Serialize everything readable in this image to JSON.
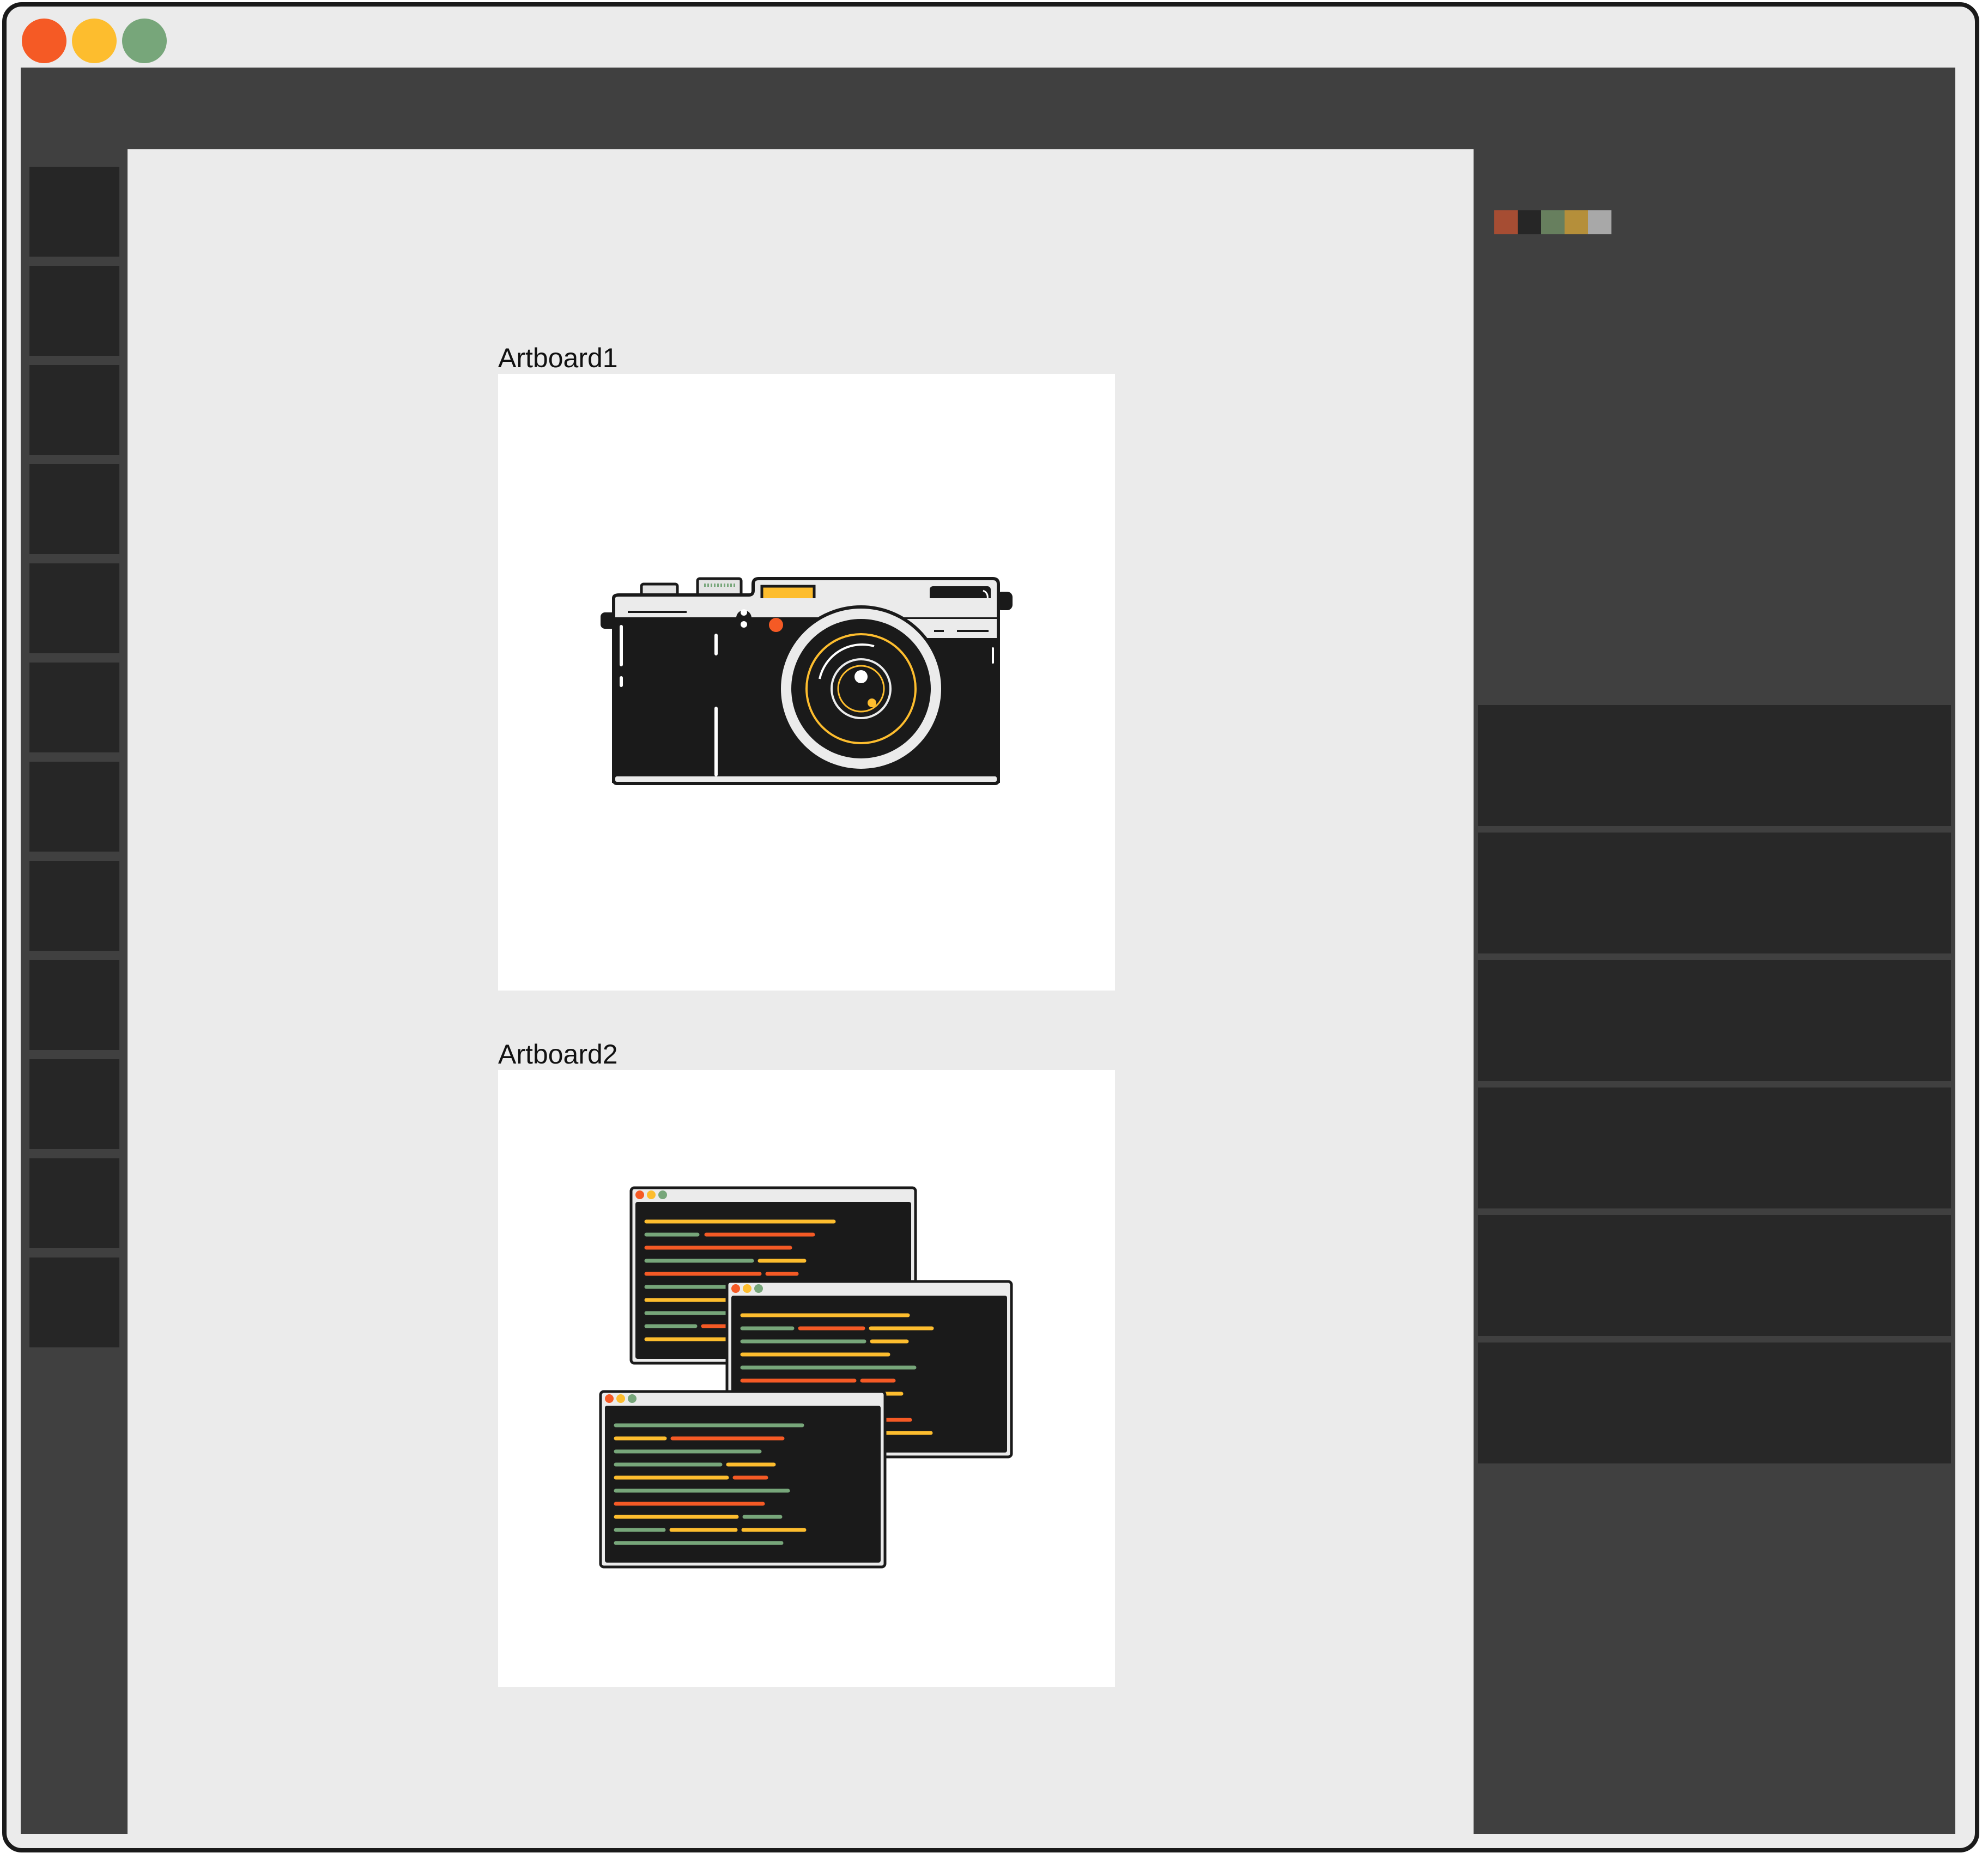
{
  "window": {
    "traffic_lights": [
      "close-button",
      "minimize-button",
      "maximize-button"
    ],
    "colors": {
      "close": "#f55a25",
      "minimize": "#fdbd2e",
      "maximize": "#77a67a"
    }
  },
  "tools_count": 12,
  "artboards": [
    {
      "label": "Artboard1",
      "illustration": "camera-icon"
    },
    {
      "label": "Artboard2",
      "illustration": "code-windows-icon"
    }
  ],
  "swatches": [
    "#a64d33",
    "#262626",
    "#677f5e",
    "#b58f3a",
    "#a8a8a8"
  ],
  "layer_rows_count": 6,
  "theme": {
    "panel": "#404040",
    "panel_dark": "#282828",
    "canvas": "#ebebeb"
  }
}
